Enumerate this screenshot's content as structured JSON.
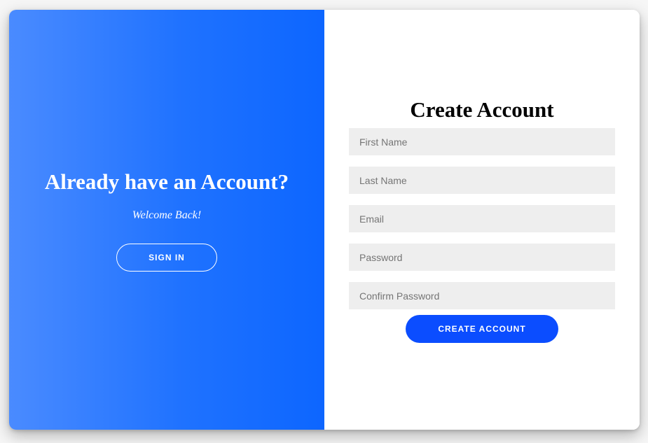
{
  "overlay": {
    "title": "Already have an Account?",
    "subtitle": "Welcome Back!",
    "sign_in_label": "SIGN IN"
  },
  "form": {
    "title": "Create Account",
    "fields": {
      "first_name": {
        "placeholder": "First Name",
        "value": ""
      },
      "last_name": {
        "placeholder": "Last Name",
        "value": ""
      },
      "email": {
        "placeholder": "Email",
        "value": ""
      },
      "password": {
        "placeholder": "Password",
        "value": ""
      },
      "confirm_password": {
        "placeholder": "Confirm Password",
        "value": ""
      }
    },
    "submit_label": "CREATE ACCOUNT"
  },
  "colors": {
    "overlay_gradient_start": "#4a8bff",
    "overlay_gradient_end": "#0d66ff",
    "primary_button": "#0b4dff",
    "field_background": "#eeeeee",
    "form_background": "#ffffff"
  }
}
